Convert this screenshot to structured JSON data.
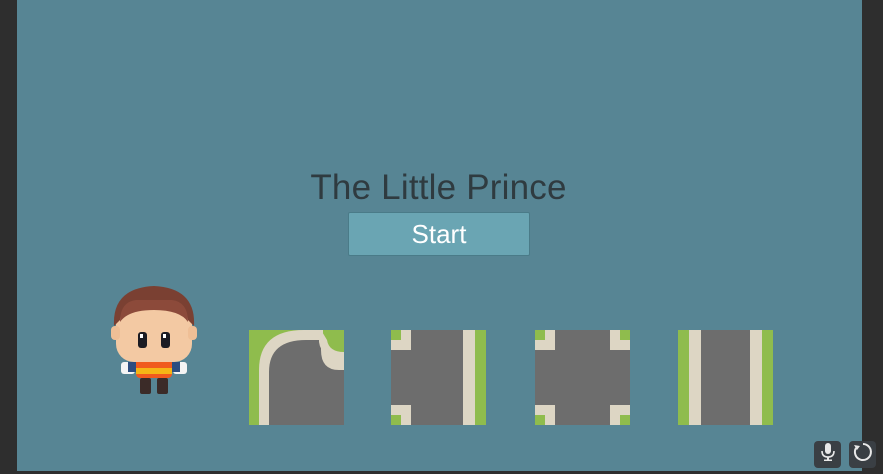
{
  "game": {
    "title": "The Little Prince",
    "start_label": "Start"
  },
  "character": {
    "name": "prince-character"
  },
  "tiles": [
    {
      "type": "road-curve"
    },
    {
      "type": "road-t-junction"
    },
    {
      "type": "road-crossroad"
    },
    {
      "type": "road-straight"
    }
  ],
  "controls": {
    "mic_icon": "microphone-icon",
    "refresh_icon": "refresh-icon"
  },
  "colors": {
    "background": "#578594",
    "button": "#6aa5b3",
    "grass": "#8fbc4d",
    "road": "#6d6d6d",
    "curb": "#ddd6c4"
  }
}
